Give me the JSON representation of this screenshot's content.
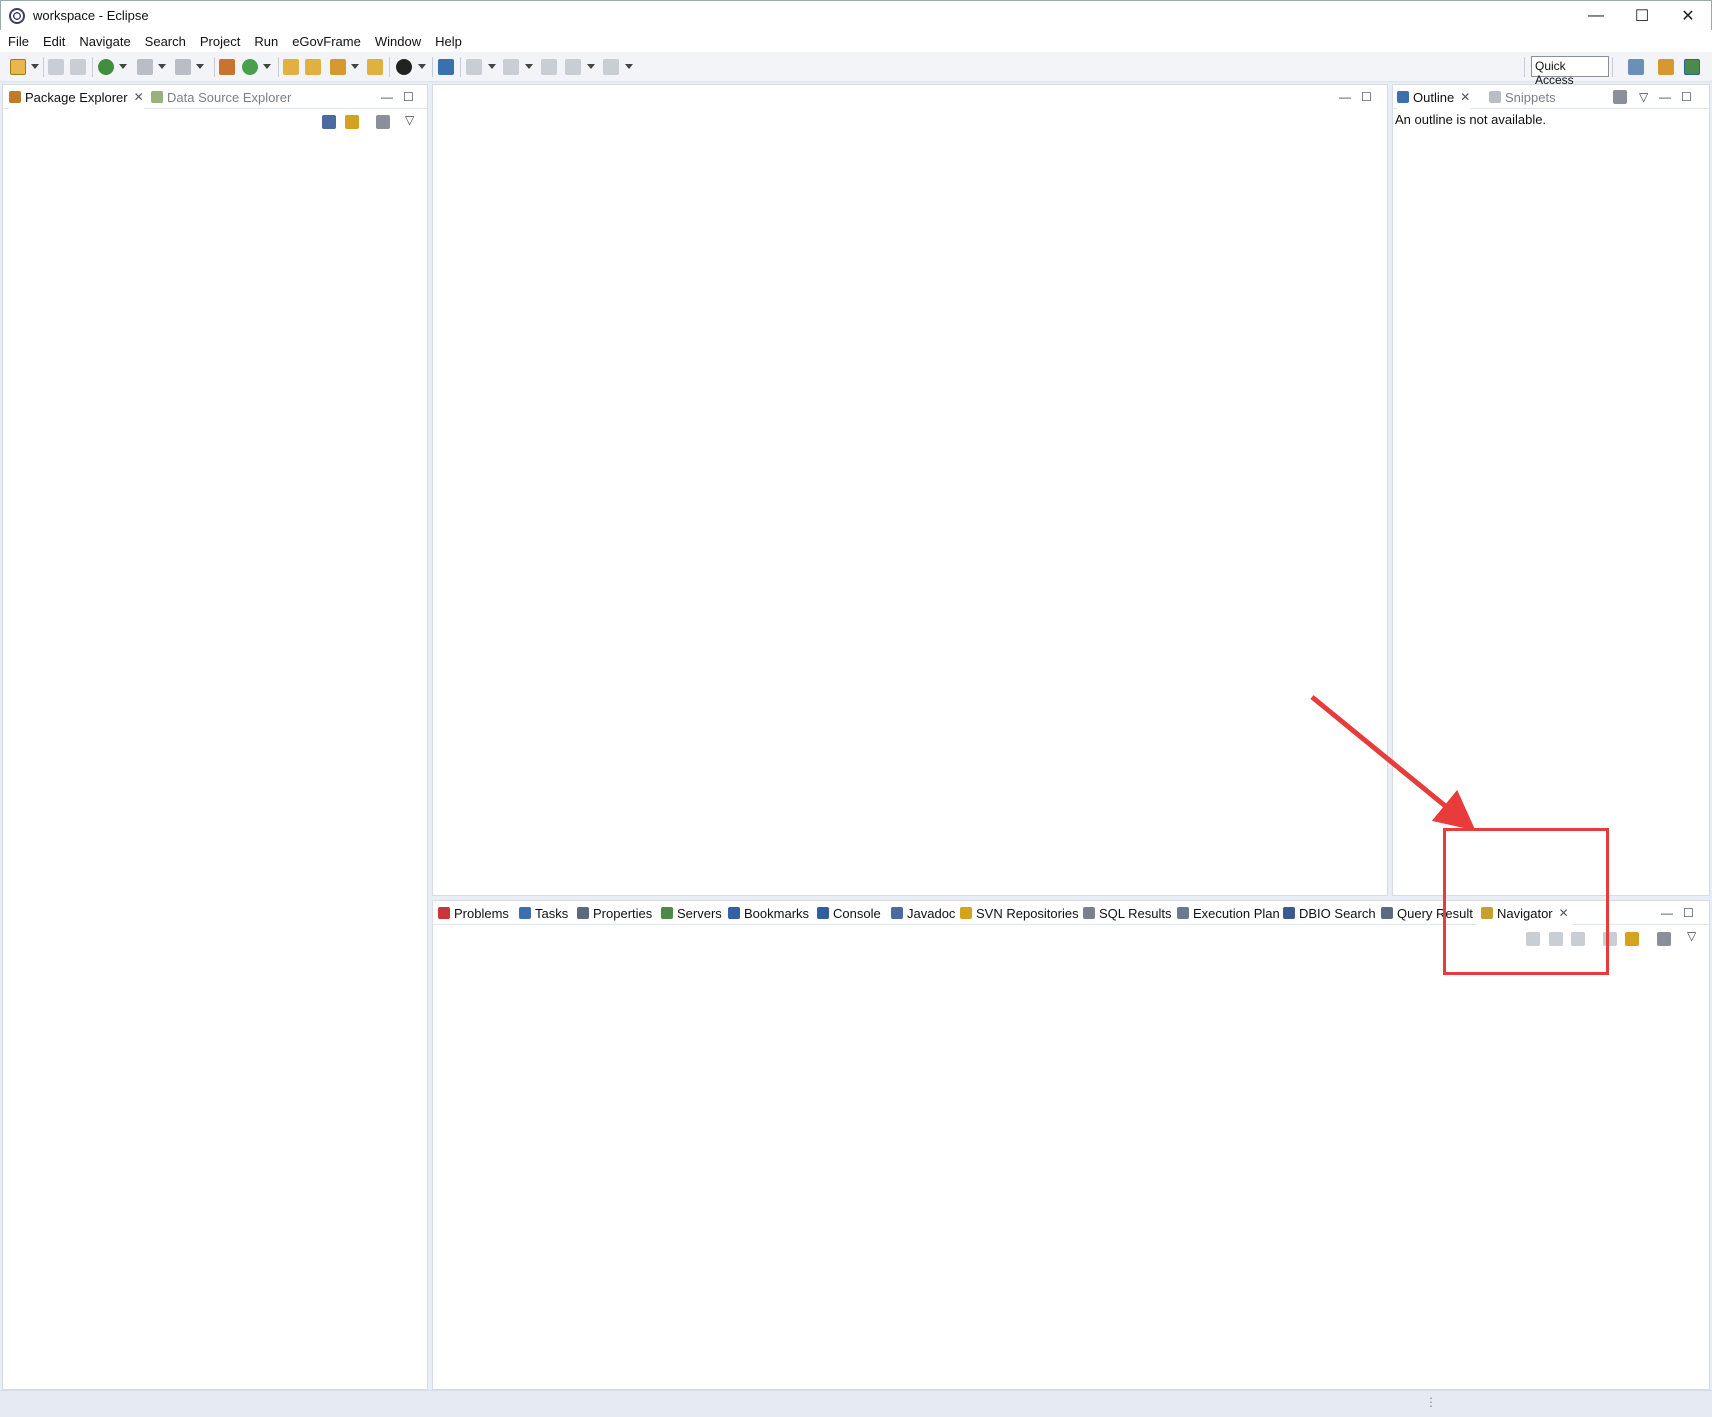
{
  "window": {
    "title": "workspace - Eclipse",
    "controls": [
      "—",
      "☐",
      "✕"
    ]
  },
  "menu": [
    "File",
    "Edit",
    "Navigate",
    "Search",
    "Project",
    "Run",
    "eGovFrame",
    "Window",
    "Help"
  ],
  "toolbar": {
    "quick_access_placeholder": "Quick Access"
  },
  "left_panel": {
    "tabs": [
      {
        "label": "Package Explorer",
        "active": true,
        "icon": "package-explorer-icon"
      },
      {
        "label": "Data Source Explorer",
        "active": false,
        "icon": "data-source-icon"
      }
    ]
  },
  "right_panel": {
    "tabs": [
      {
        "label": "Outline",
        "active": true,
        "icon": "outline-icon"
      },
      {
        "label": "Snippets",
        "active": false,
        "icon": "snippets-icon"
      }
    ],
    "message": "An outline is not available."
  },
  "bottom_panel": {
    "tabs": [
      {
        "label": "Problems",
        "icon": "problems-icon",
        "color": "#c83737"
      },
      {
        "label": "Tasks",
        "icon": "tasks-icon",
        "color": "#3a6fb0"
      },
      {
        "label": "Properties",
        "icon": "properties-icon",
        "color": "#5a6b80"
      },
      {
        "label": "Servers",
        "icon": "servers-icon",
        "color": "#4c8a4c"
      },
      {
        "label": "Bookmarks",
        "icon": "bookmarks-icon",
        "color": "#3560a8"
      },
      {
        "label": "Console",
        "icon": "console-icon",
        "color": "#2f5fa0"
      },
      {
        "label": "Javadoc",
        "icon": "javadoc-icon",
        "color": "#4a6aa0"
      },
      {
        "label": "SVN Repositories",
        "icon": "svn-icon",
        "color": "#d4a21f"
      },
      {
        "label": "SQL Results",
        "icon": "sql-results-icon",
        "color": "#7a8090"
      },
      {
        "label": "Execution Plan",
        "icon": "execution-plan-icon",
        "color": "#6a7a90"
      },
      {
        "label": "DBIO Search",
        "icon": "dbio-search-icon",
        "color": "#3a5a90"
      },
      {
        "label": "Query Result",
        "icon": "query-result-icon",
        "color": "#5a6a80"
      },
      {
        "label": "Navigator",
        "icon": "navigator-icon",
        "color": "#c8a030",
        "active": true
      }
    ]
  },
  "colors": {
    "annotation": "#e83b3b",
    "frame_bg": "#e9edf5"
  }
}
